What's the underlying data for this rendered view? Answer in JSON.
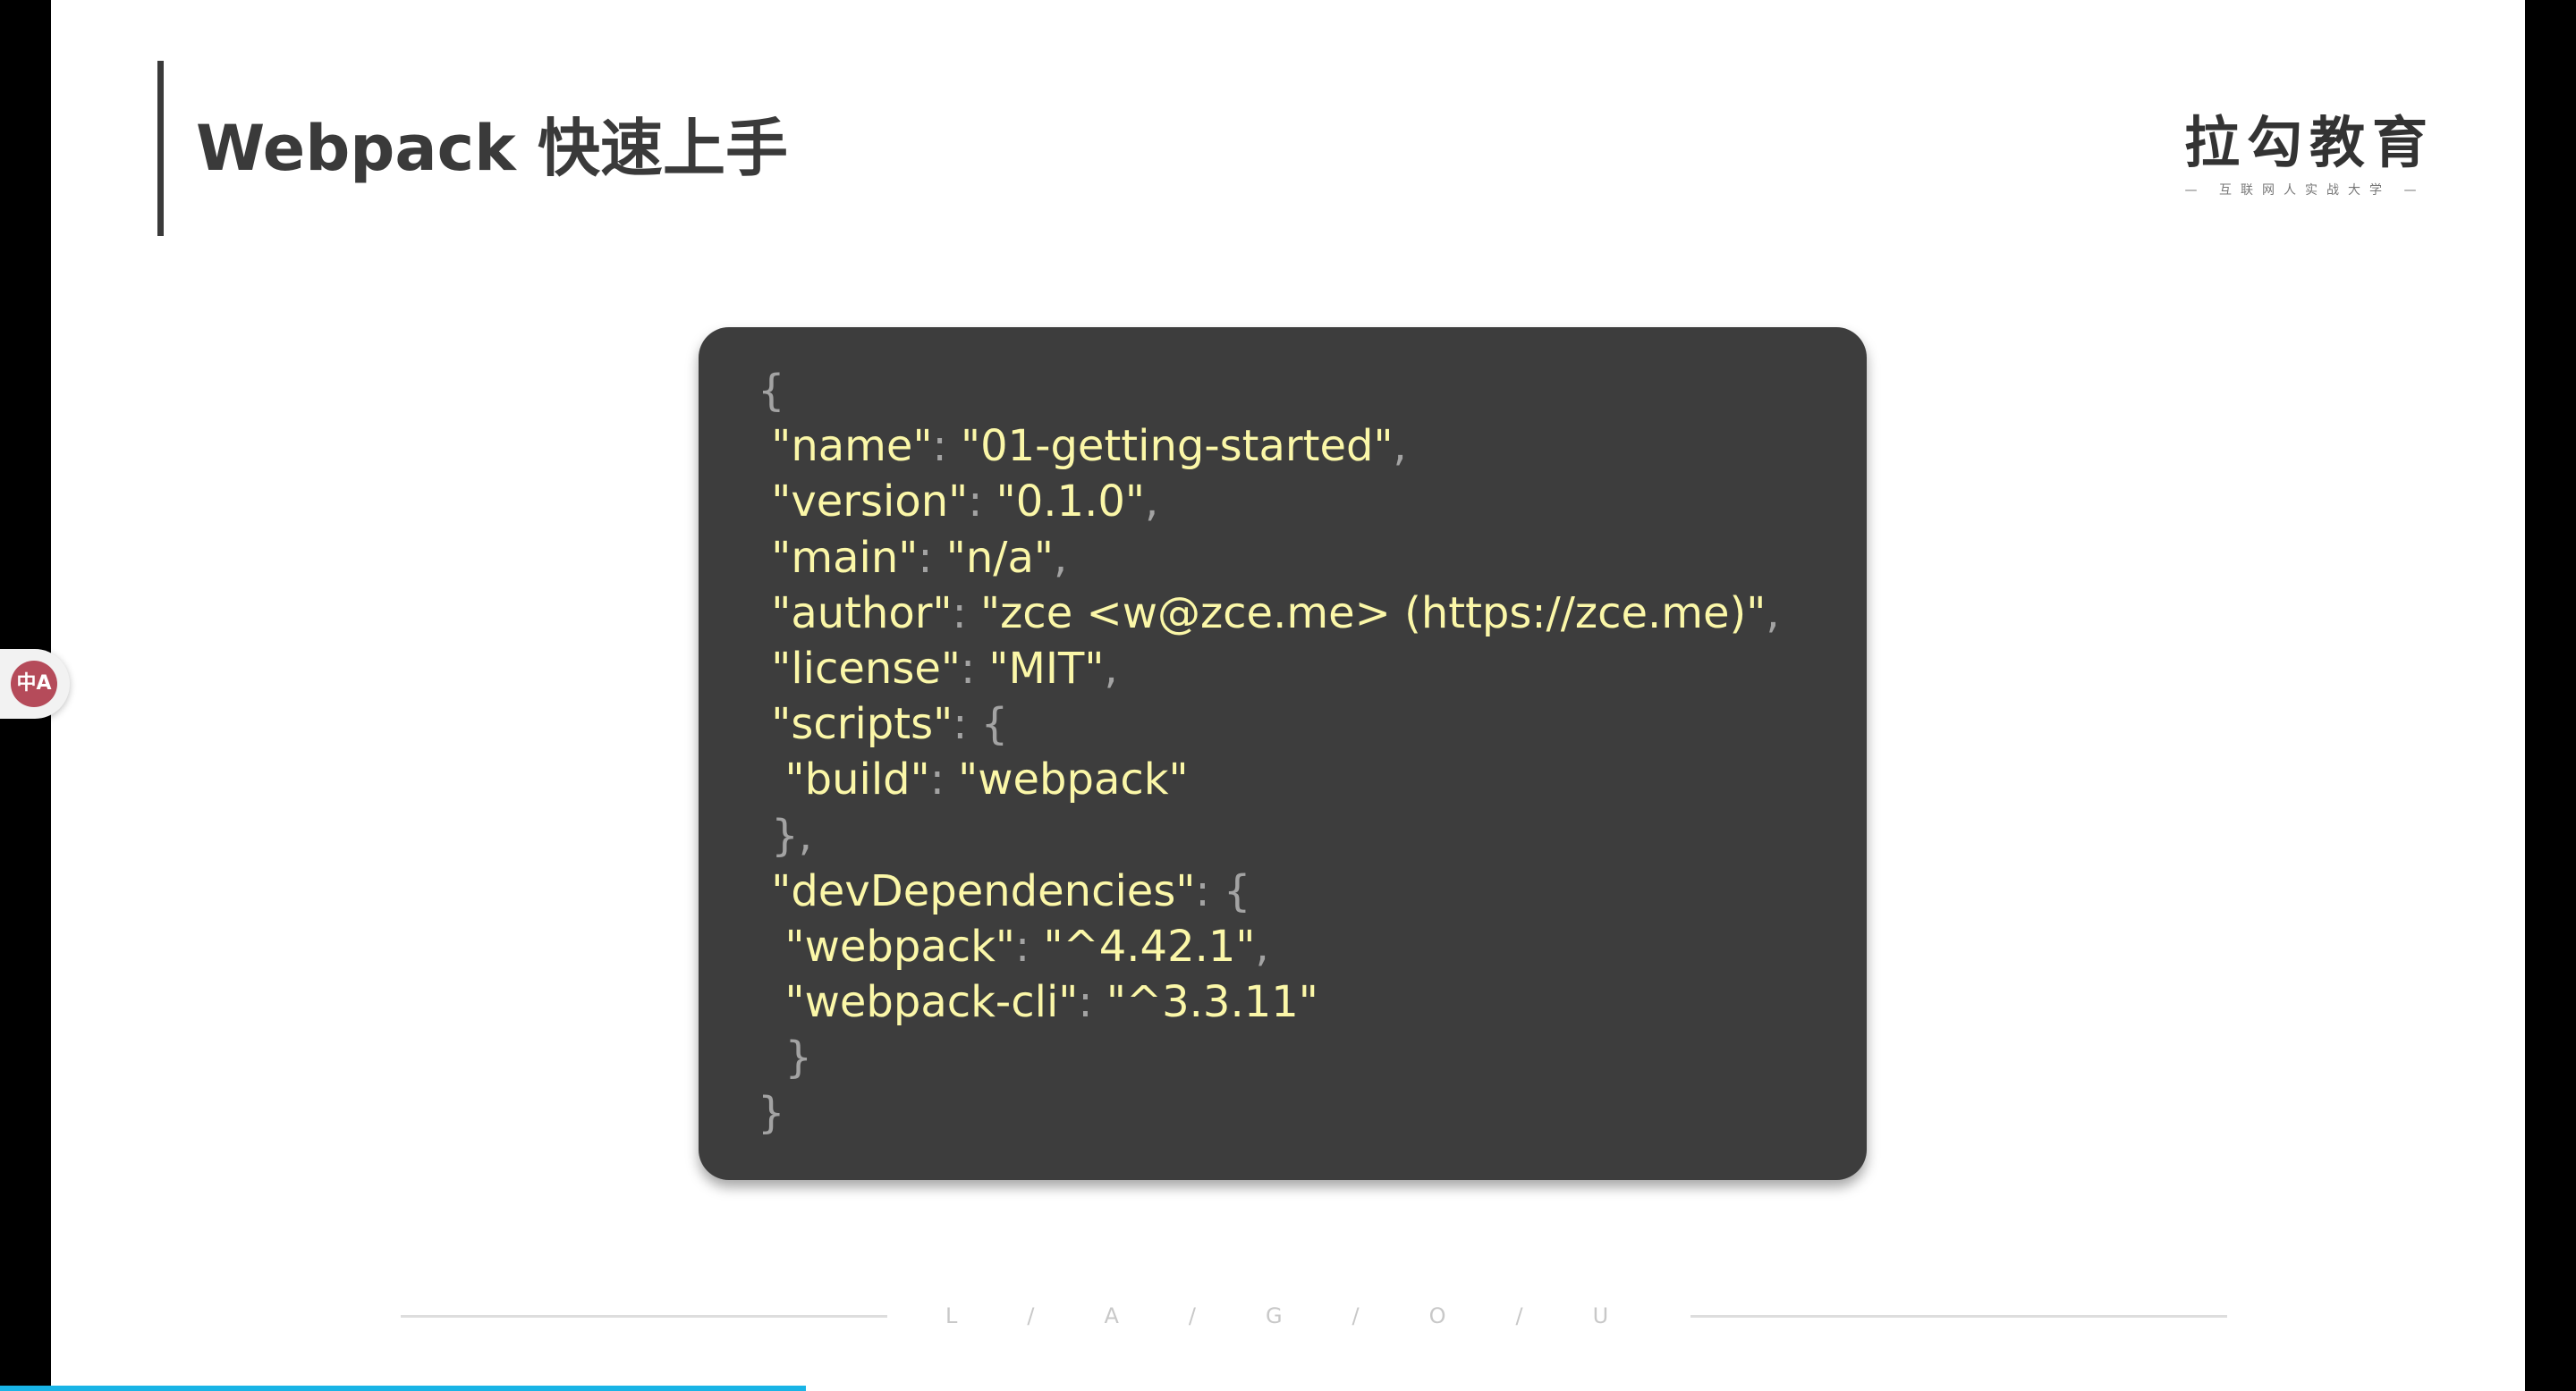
{
  "slide": {
    "title": "Webpack 快速上手",
    "brand": {
      "name": "拉勾教育",
      "slogan": "— 互联网人实战大学 —"
    },
    "code_lines": [
      [
        {
          "t": "{",
          "c": "punct"
        }
      ],
      [
        {
          "t": " \"name\"",
          "c": "key"
        },
        {
          "t": ": ",
          "c": "punct"
        },
        {
          "t": "\"01-getting-started\"",
          "c": "str"
        },
        {
          "t": ",",
          "c": "punct"
        }
      ],
      [
        {
          "t": " \"version\"",
          "c": "key"
        },
        {
          "t": ": ",
          "c": "punct"
        },
        {
          "t": "\"0.1.0\"",
          "c": "str"
        },
        {
          "t": ",",
          "c": "punct"
        }
      ],
      [
        {
          "t": " \"main\"",
          "c": "key"
        },
        {
          "t": ": ",
          "c": "punct"
        },
        {
          "t": "\"n/a\"",
          "c": "str"
        },
        {
          "t": ",",
          "c": "punct"
        }
      ],
      [
        {
          "t": " \"author\"",
          "c": "key"
        },
        {
          "t": ": ",
          "c": "punct"
        },
        {
          "t": "\"zce <w@zce.me> (https://zce.me)\"",
          "c": "str"
        },
        {
          "t": ",",
          "c": "punct"
        }
      ],
      [
        {
          "t": " \"license\"",
          "c": "key"
        },
        {
          "t": ": ",
          "c": "punct"
        },
        {
          "t": "\"MIT\"",
          "c": "str"
        },
        {
          "t": ",",
          "c": "punct"
        }
      ],
      [
        {
          "t": " \"scripts\"",
          "c": "key"
        },
        {
          "t": ": {",
          "c": "punct"
        }
      ],
      [
        {
          "t": "  \"build\"",
          "c": "key"
        },
        {
          "t": ": ",
          "c": "punct"
        },
        {
          "t": "\"webpack\"",
          "c": "str"
        }
      ],
      [
        {
          "t": " },",
          "c": "punct"
        }
      ],
      [
        {
          "t": " \"devDependencies\"",
          "c": "key"
        },
        {
          "t": ": {",
          "c": "punct"
        }
      ],
      [
        {
          "t": "  \"webpack\"",
          "c": "key"
        },
        {
          "t": ": ",
          "c": "punct"
        },
        {
          "t": "\"^4.42.1\"",
          "c": "str"
        },
        {
          "t": ",",
          "c": "punct"
        }
      ],
      [
        {
          "t": "  \"webpack-cli\"",
          "c": "key"
        },
        {
          "t": ": ",
          "c": "punct"
        },
        {
          "t": "\"^3.3.11\"",
          "c": "str"
        }
      ],
      [
        {
          "t": "  }",
          "c": "punct"
        }
      ],
      [
        {
          "t": "}",
          "c": "punct"
        }
      ]
    ],
    "footer_brand": "L/A/G/O/U"
  },
  "extension_badge": {
    "icon": "translate-icon",
    "label": "中A"
  },
  "progress": {
    "fraction": 0.313
  },
  "colors": {
    "code_bg": "#3d3d3d",
    "code_key": "#fbf7a8",
    "code_punct": "#a3a3a3",
    "progress": "#18b4e6"
  }
}
